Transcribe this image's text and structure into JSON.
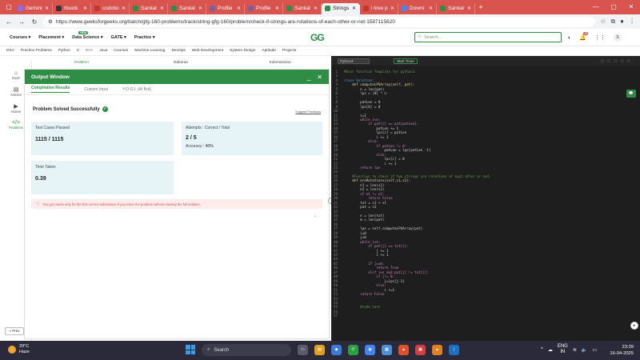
{
  "browser": {
    "tabs": [
      {
        "label": "Gemini",
        "fav": "#8a6cf0",
        "active": false
      },
      {
        "label": "rbuick",
        "fav": "#333333",
        "active": false
      },
      {
        "label": "codolio",
        "fav": "#c0392b",
        "active": false
      },
      {
        "label": "Sankal",
        "fav": "#2f8d46",
        "active": false
      },
      {
        "label": "Sankal",
        "fav": "#2f8d46",
        "active": false
      },
      {
        "label": "Profile",
        "fav": "#7b5ea7",
        "active": false
      },
      {
        "label": "Profile",
        "fav": "#7b5ea7",
        "active": false
      },
      {
        "label": "Sankal",
        "fav": "#2f8d46",
        "active": false
      },
      {
        "label": "Strings",
        "fav": "#2f8d46",
        "active": true
      },
      {
        "label": "i love p",
        "fav": "#c0392b",
        "active": false
      },
      {
        "label": "Downl",
        "fav": "#4285f4",
        "active": false
      },
      {
        "label": "Sankal",
        "fav": "#2f8d46",
        "active": false
      }
    ],
    "url_scheme": "https://",
    "url": "www.geeksforgeeks.org/batch/gfg-160-problems/track/string-gfg-160/problem/check-if-strings-are-rotations-of-each-other-or-not-1587115620"
  },
  "gfg": {
    "menus": [
      "Courses ▾",
      "Placement ▾",
      "Data Science ▾",
      "GATE ▾",
      "Practice ▾"
    ],
    "logo": "GG",
    "search_placeholder": "Search...",
    "notif_count": "45",
    "avatar": "S"
  },
  "subnav": [
    "DSA",
    "Practice Problems",
    "Python",
    "C",
    "C++",
    "Java",
    "Courses",
    "Machine Learning",
    "DevOps",
    "Web Development",
    "System Design",
    "Aptitude",
    "Projects"
  ],
  "rail": {
    "items": [
      "Dash",
      "Articles",
      "Videos",
      "Problems"
    ],
    "prev": "« Prev"
  },
  "problem_tabs": [
    "Problem",
    "Editorial",
    "Submissions"
  ],
  "output": {
    "title": "Output Window",
    "tabs": [
      "Compilation Results",
      "Custom Input",
      "Y.O.G.I. (AI Bot)"
    ],
    "status": "Problem Solved Successfully",
    "feedback": "Suggest Feedback",
    "test_cases_label": "Test Cases Passed",
    "test_cases_value": "1115 / 1115",
    "attempts_label": "Attempts : Correct / Total",
    "attempts_value": "2 / 5",
    "accuracy_label": "Accuracy :",
    "accuracy_value": "40%",
    "time_label": "Time Taken",
    "time_value": "0.39",
    "warning": "You get marks only for the first correct submission if you solve the problem without viewing the full solution."
  },
  "editor": {
    "language": "Python3",
    "timer": "Start Timer",
    "lines": [
      {
        "n": "1",
        "t": "#User function Template for python3",
        "cls": "c-cm"
      },
      {
        "n": "2",
        "t": "",
        "cls": ""
      },
      {
        "n": "3",
        "t": "class Solution:",
        "cls": "c-kw"
      },
      {
        "n": "4",
        "t": "    def computeLPSArray(self, pat):",
        "cls": "c-fn"
      },
      {
        "n": "5",
        "t": "        n = len(pat)",
        "cls": ""
      },
      {
        "n": "6",
        "t": "        lps = [0] * n",
        "cls": ""
      },
      {
        "n": "7",
        "t": "",
        "cls": ""
      },
      {
        "n": "8",
        "t": "        patLen = 0",
        "cls": ""
      },
      {
        "n": "9",
        "t": "        lps[0] = 0",
        "cls": ""
      },
      {
        "n": "10",
        "t": "",
        "cls": ""
      },
      {
        "n": "11",
        "t": "        i=1",
        "cls": ""
      },
      {
        "n": "12",
        "t": "        while i<n:",
        "cls": "c-ctl"
      },
      {
        "n": "13",
        "t": "            if pat[i] == pat[patLen]:",
        "cls": "c-ctl"
      },
      {
        "n": "14",
        "t": "                patLen += 1",
        "cls": ""
      },
      {
        "n": "15",
        "t": "                lps[i] = patLen",
        "cls": ""
      },
      {
        "n": "16",
        "t": "                i += 1",
        "cls": ""
      },
      {
        "n": "17",
        "t": "            else:",
        "cls": "c-ctl"
      },
      {
        "n": "18",
        "t": "                if patLen != 0:",
        "cls": "c-ctl"
      },
      {
        "n": "19",
        "t": "                    patLen = lps[patLen -1]",
        "cls": ""
      },
      {
        "n": "20",
        "t": "                else:",
        "cls": "c-ctl"
      },
      {
        "n": "21",
        "t": "                    lps[i] = 0",
        "cls": ""
      },
      {
        "n": "22",
        "t": "                    i += 1",
        "cls": ""
      },
      {
        "n": "23",
        "t": "        return lps",
        "cls": "c-ctl"
      },
      {
        "n": "24",
        "t": "",
        "cls": ""
      },
      {
        "n": "25",
        "t": "    #Function to check if two strings are rotations of each other or not.",
        "cls": "c-cm"
      },
      {
        "n": "26",
        "t": "    def areRotations(self,s1,s2):",
        "cls": "c-fn"
      },
      {
        "n": "27",
        "t": "        n1 = len(s1)",
        "cls": ""
      },
      {
        "n": "28",
        "t": "        n2 = len(s2)",
        "cls": ""
      },
      {
        "n": "29",
        "t": "        if n1 != n2:",
        "cls": "c-ctl"
      },
      {
        "n": "30",
        "t": "            return False",
        "cls": "c-ctl"
      },
      {
        "n": "31",
        "t": "        txt = s1 + s1",
        "cls": ""
      },
      {
        "n": "32",
        "t": "        pat = s2",
        "cls": ""
      },
      {
        "n": "33",
        "t": "",
        "cls": ""
      },
      {
        "n": "34",
        "t": "        n = len(txt)",
        "cls": ""
      },
      {
        "n": "35",
        "t": "        m = len(pat)",
        "cls": ""
      },
      {
        "n": "36",
        "t": "",
        "cls": ""
      },
      {
        "n": "37",
        "t": "        lps = self.computeLPSArray(pat)",
        "cls": ""
      },
      {
        "n": "38",
        "t": "        i=0",
        "cls": ""
      },
      {
        "n": "39",
        "t": "        j=0",
        "cls": ""
      },
      {
        "n": "40",
        "t": "        while i<n:",
        "cls": "c-ctl"
      },
      {
        "n": "41",
        "t": "            if pat[j] == txt[i]:",
        "cls": "c-ctl"
      },
      {
        "n": "42",
        "t": "                j += 1",
        "cls": ""
      },
      {
        "n": "43",
        "t": "                i += 1",
        "cls": ""
      },
      {
        "n": "44",
        "t": "",
        "cls": ""
      },
      {
        "n": "45",
        "t": "            if j==m:",
        "cls": "c-ctl"
      },
      {
        "n": "46",
        "t": "                return True",
        "cls": "c-ctl"
      },
      {
        "n": "47",
        "t": "            elif i<n and pat[j] != txt[i]:",
        "cls": "c-ctl"
      },
      {
        "n": "48",
        "t": "                if j!= 0:",
        "cls": "c-ctl"
      },
      {
        "n": "49",
        "t": "                    j=lps[j-1]",
        "cls": ""
      },
      {
        "n": "50",
        "t": "                else:",
        "cls": "c-ctl"
      },
      {
        "n": "51",
        "t": "                    i +=1",
        "cls": ""
      },
      {
        "n": "52",
        "t": "        return False",
        "cls": "c-ctl"
      },
      {
        "n": "53",
        "t": "",
        "cls": ""
      },
      {
        "n": "54",
        "t": "",
        "cls": ""
      },
      {
        "n": "55",
        "t": "        #code here",
        "cls": "c-cm"
      },
      {
        "n": "56",
        "t": "",
        "cls": ""
      },
      {
        "n": "57",
        "t": "",
        "cls": ""
      }
    ]
  },
  "taskbar": {
    "temp": "29°C",
    "weather": "Haze",
    "weather_badge": "1",
    "search": "Search",
    "lang1": "ENG",
    "lang2": "IN",
    "time": "23:39",
    "date": "16-04-2025"
  }
}
